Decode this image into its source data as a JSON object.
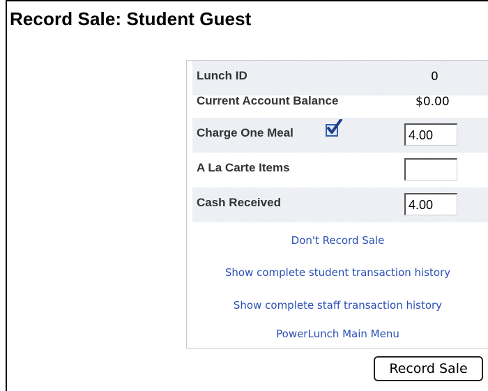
{
  "page": {
    "title": "Record Sale: Student Guest"
  },
  "form": {
    "lunch_id": {
      "label": "Lunch ID",
      "value": "0"
    },
    "balance": {
      "label": "Current Account Balance",
      "value": "$0.00"
    },
    "charge_meal": {
      "label": "Charge One Meal",
      "checked": true,
      "amount": "4.00"
    },
    "a_la_carte": {
      "label": "A La Carte Items",
      "amount": ""
    },
    "cash_received": {
      "label": "Cash Received",
      "amount": "4.00"
    }
  },
  "links": {
    "dont_record": "Don't Record Sale",
    "student_history": "Show complete student transaction history",
    "staff_history": "Show complete staff transaction history",
    "main_menu": "PowerLunch Main Menu"
  },
  "actions": {
    "submit_label": "Record Sale"
  },
  "colors": {
    "link": "#2a4fb5",
    "checkbox": "#2f5fa8",
    "row_shade": "#e9ecf1"
  }
}
